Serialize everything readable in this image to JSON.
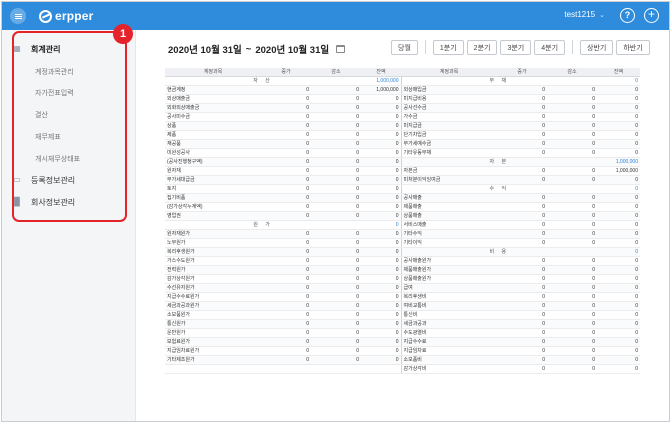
{
  "header": {
    "app_name": "erpper",
    "user": "test1215",
    "help_icon": "question-circle-icon",
    "add_icon": "plus-circle-icon"
  },
  "sidebar": {
    "groups": [
      {
        "label": "회계관리",
        "icon": "chart-icon"
      },
      {
        "label": "등록정보관리",
        "icon": "monitor-icon"
      },
      {
        "label": "회사정보관리",
        "icon": "building-icon"
      }
    ],
    "sub_items": [
      "계정과목관리",
      "자가전표입력",
      "결산",
      "재무제표",
      "개시재무상태표"
    ],
    "callout_number": "1"
  },
  "main": {
    "date_start": "2020년 10월 31일",
    "date_sep": "~",
    "date_end": "2020년 10월 31일",
    "buttons": [
      "당월",
      "1분기",
      "2분기",
      "3분기",
      "4분기",
      "상반기",
      "하반기"
    ]
  },
  "table": {
    "columns": [
      "계정과목",
      "증가",
      "감소",
      "잔액",
      "계정과목",
      "증가",
      "감소",
      "잔액"
    ],
    "sections": {
      "asset": "자 산",
      "liability": "부 채",
      "capital": "자 본",
      "revenue": "수 익",
      "cost": "원 가",
      "expense": "비 용"
    },
    "rows": [
      [
        "",
        "",
        "",
        "1,000,000",
        "",
        "",
        "",
        "0"
      ],
      [
        "현금계정",
        "0",
        "0",
        "1,000,000",
        "외상매입금",
        "0",
        "0",
        "0"
      ],
      [
        "외상매출금",
        "0",
        "0",
        "0",
        "미지급비용",
        "0",
        "0",
        "0"
      ],
      [
        "외화외상매출금",
        "0",
        "0",
        "0",
        "공사선수금",
        "0",
        "0",
        "0"
      ],
      [
        "공사미수금",
        "0",
        "0",
        "0",
        "가수금",
        "0",
        "0",
        "0"
      ],
      [
        "상품",
        "0",
        "0",
        "0",
        "미지급금",
        "0",
        "0",
        "0"
      ],
      [
        "제품",
        "0",
        "0",
        "0",
        "단기차입금",
        "0",
        "0",
        "0"
      ],
      [
        "재공품",
        "0",
        "0",
        "0",
        "부가세예수금",
        "0",
        "0",
        "0"
      ],
      [
        "미완성공사",
        "0",
        "0",
        "0",
        "기타유동부채",
        "0",
        "0",
        "0"
      ],
      [
        "(공사진행청구액)",
        "0",
        "0",
        "0",
        "",
        "",
        "",
        "1,000,000"
      ],
      [
        "원자재",
        "0",
        "0",
        "0",
        "자본금",
        "0",
        "0",
        "1,000,000"
      ],
      [
        "부가세대급금",
        "0",
        "0",
        "0",
        "미처분이익잉여금",
        "0",
        "0",
        "0"
      ],
      [
        "토지",
        "0",
        "0",
        "0",
        "",
        "",
        "",
        "0"
      ],
      [
        "집기비품",
        "0",
        "0",
        "0",
        "공사매출",
        "0",
        "0",
        "0"
      ],
      [
        "(감가상각누계액)",
        "0",
        "0",
        "0",
        "제품매출",
        "0",
        "0",
        "0"
      ],
      [
        "영업권",
        "0",
        "0",
        "0",
        "상품매출",
        "0",
        "0",
        "0"
      ],
      [
        "",
        "",
        "",
        "0",
        "서비스매출",
        "0",
        "0",
        "0"
      ],
      [
        "원자재원가",
        "0",
        "0",
        "0",
        "기타수익",
        "0",
        "0",
        "0"
      ],
      [
        "노무원가",
        "0",
        "0",
        "0",
        "기타이익",
        "0",
        "0",
        "0"
      ],
      [
        "복리후생원가",
        "0",
        "0",
        "0",
        "",
        "",
        "",
        "0"
      ],
      [
        "가스수도원가",
        "0",
        "0",
        "0",
        "공사매출원가",
        "0",
        "0",
        "0"
      ],
      [
        "전력원가",
        "0",
        "0",
        "0",
        "제품매출원가",
        "0",
        "0",
        "0"
      ],
      [
        "감가상각원가",
        "0",
        "0",
        "0",
        "상품매출원가",
        "0",
        "0",
        "0"
      ],
      [
        "수선유지원가",
        "0",
        "0",
        "0",
        "급여",
        "0",
        "0",
        "0"
      ],
      [
        "지급수수료원가",
        "0",
        "0",
        "0",
        "복리후생비",
        "0",
        "0",
        "0"
      ],
      [
        "세금과공과원가",
        "0",
        "0",
        "0",
        "여비교통비",
        "0",
        "0",
        "0"
      ],
      [
        "소모품원가",
        "0",
        "0",
        "0",
        "통신비",
        "0",
        "0",
        "0"
      ],
      [
        "통신원가",
        "0",
        "0",
        "0",
        "세금과공과",
        "0",
        "0",
        "0"
      ],
      [
        "운반원가",
        "0",
        "0",
        "0",
        "수도광열비",
        "0",
        "0",
        "0"
      ],
      [
        "보험료원가",
        "0",
        "0",
        "0",
        "지급수수료",
        "0",
        "0",
        "0"
      ],
      [
        "지급임차료원가",
        "0",
        "0",
        "0",
        "지급임차료",
        "0",
        "0",
        "0"
      ],
      [
        "기타제조원가",
        "0",
        "0",
        "0",
        "소모품비",
        "0",
        "0",
        "0"
      ],
      [
        "",
        "",
        "",
        "",
        "감가상각비",
        "0",
        "0",
        "0"
      ]
    ]
  }
}
